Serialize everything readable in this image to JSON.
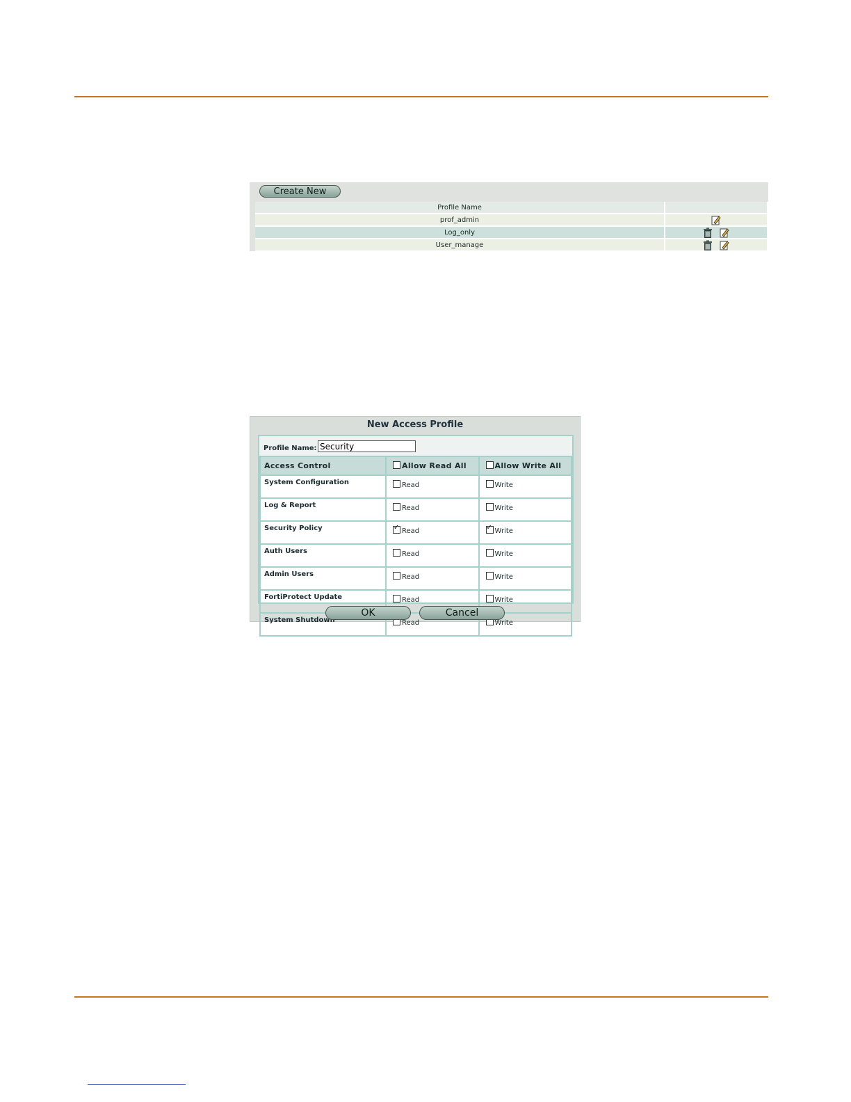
{
  "profile_list": {
    "create_button_label": "Create New",
    "column_header": "Profile Name",
    "rows": [
      {
        "name": "prof_admin",
        "can_delete": false
      },
      {
        "name": "Log_only",
        "can_delete": true
      },
      {
        "name": "User_manage",
        "can_delete": true
      }
    ]
  },
  "dialog": {
    "title": "New Access Profile",
    "profile_name_label": "Profile Name:",
    "profile_name_value": "Security",
    "header": {
      "access_control": "Access Control",
      "allow_read_all": "Allow Read All",
      "allow_write_all": "Allow Write All"
    },
    "read_label": "Read",
    "write_label": "Write",
    "permissions": [
      {
        "label": "System Configuration",
        "read": false,
        "write": false
      },
      {
        "label": "Log & Report",
        "read": false,
        "write": false
      },
      {
        "label": "Security Policy",
        "read": true,
        "write": true
      },
      {
        "label": "Auth Users",
        "read": false,
        "write": false
      },
      {
        "label": "Admin Users",
        "read": false,
        "write": false
      },
      {
        "label": "FortiProtect Update",
        "read": false,
        "write": false
      },
      {
        "label": "System Shutdown",
        "read": false,
        "write": false
      }
    ],
    "ok_label": "OK",
    "cancel_label": "Cancel"
  },
  "colors": {
    "rule": "#c8741e",
    "button_top": "#c3d4ce",
    "button_bottom": "#89a29a",
    "header_row": "#c7dcd8",
    "grid_border": "#a3d2cb"
  }
}
